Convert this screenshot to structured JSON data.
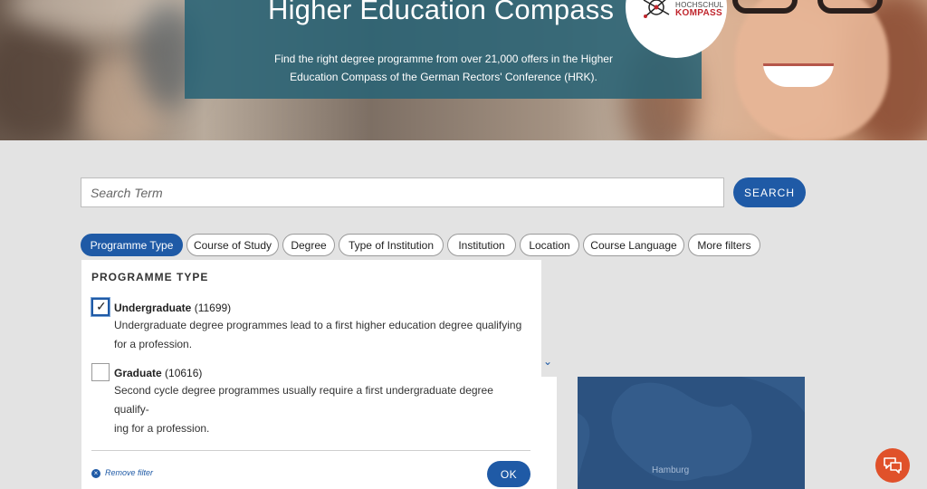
{
  "hero": {
    "title": "Higher Education Compass",
    "subtitle": "Find the right degree programme from over 21,000 offers in the Higher Education Compass of the German Rectors' Conference (HRK).",
    "logo": {
      "line1": "HOCHSCHUL",
      "line2": "KOMPASS",
      "color": "#c0262d"
    }
  },
  "search": {
    "placeholder": "Search Term",
    "button_label": "SEARCH"
  },
  "filters": {
    "chips": [
      {
        "label": "Programme Type",
        "active": true
      },
      {
        "label": "Course of Study",
        "active": false
      },
      {
        "label": "Degree",
        "active": false
      },
      {
        "label": "Type of Institution",
        "active": false
      },
      {
        "label": "Institution",
        "active": false
      },
      {
        "label": "Location",
        "active": false
      },
      {
        "label": "Course Language",
        "active": false
      },
      {
        "label": "More filters",
        "active": false
      }
    ]
  },
  "dropdown": {
    "title": "PROGRAMME TYPE",
    "options": [
      {
        "name": "Undergraduate",
        "count": "(11699)",
        "checked": true,
        "desc_line1": "Undergraduate degree programmes lead to a first higher education degree qualifying",
        "desc_line2": "for a profession."
      },
      {
        "name": "Graduate",
        "count": "(10616)",
        "checked": false,
        "desc_line1": "Second cycle degree programmes usually require a first undergraduate degree qualify-",
        "desc_line2": "ing for a profession."
      }
    ],
    "remove_filter": "Remove filter",
    "ok_label": "OK"
  },
  "map": {
    "city_label": "Hamburg"
  },
  "colors": {
    "accent": "#1f5aa6",
    "chat": "#e0512a",
    "panel": "#296375"
  },
  "icons": {
    "chat": "chat-bubbles-icon",
    "remove": "close-circle-icon",
    "chevron": "chevron-down-icon",
    "check": "check-icon"
  }
}
